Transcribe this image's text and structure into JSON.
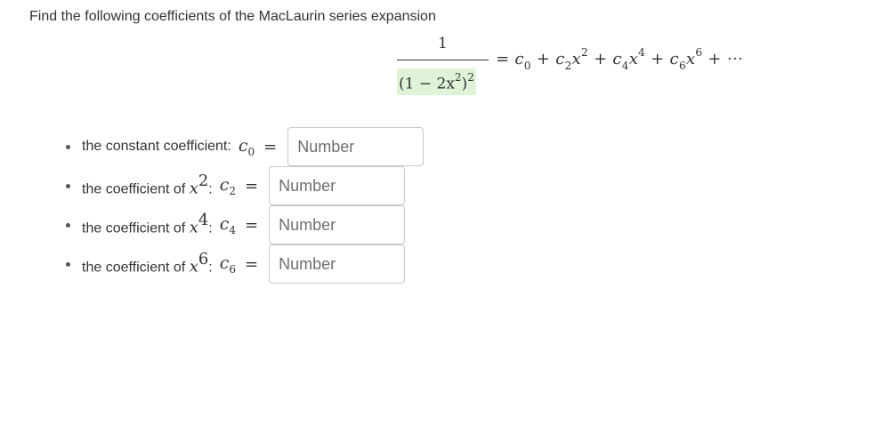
{
  "prompt": "Find the following coefficients of the MacLaurin series expansion",
  "formula": {
    "numerator": "1",
    "denominator_base": "(1 − 2x",
    "denominator_inner_exp": "2",
    "denominator_close": ")",
    "denominator_outer_exp": "2",
    "rhs": {
      "eq": "=",
      "c0": "c",
      "c0_sub": "0",
      "plus1": "+",
      "c2": "c",
      "c2_sub": "2",
      "x2": "x",
      "x2_exp": "2",
      "plus2": "+",
      "c4": "c",
      "c4_sub": "4",
      "x4": "x",
      "x4_exp": "4",
      "plus3": "+",
      "c6": "c",
      "c6_sub": "6",
      "x6": "x",
      "x6_exp": "6",
      "tail": "+ ⋯"
    }
  },
  "questions": [
    {
      "text": "the constant coefficient:",
      "var": "c",
      "var_sub": "0",
      "eq": "=",
      "placeholder": "Number"
    },
    {
      "text": "the coefficient of",
      "power_var": "x",
      "power": "2",
      "colon": ":",
      "var": "c",
      "var_sub": "2",
      "eq": "=",
      "placeholder": "Number"
    },
    {
      "text": "the coefficient of",
      "power_var": "x",
      "power": "4",
      "colon": ":",
      "var": "c",
      "var_sub": "4",
      "eq": "=",
      "placeholder": "Number"
    },
    {
      "text": "the coefficient of",
      "power_var": "x",
      "power": "6",
      "colon": ":",
      "var": "c",
      "var_sub": "6",
      "eq": "=",
      "placeholder": "Number"
    }
  ],
  "colors": {
    "denominator_highlight": "#dff3d8",
    "input_border": "#c8c8c8"
  }
}
